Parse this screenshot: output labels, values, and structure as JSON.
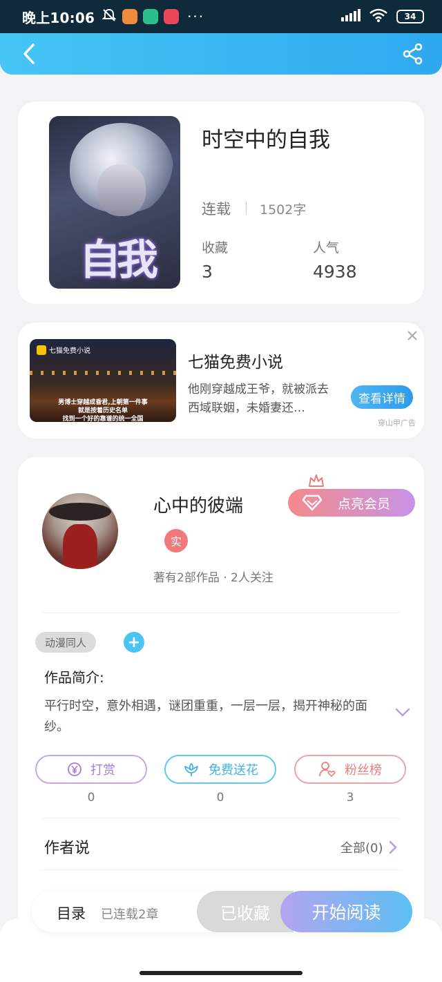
{
  "status_bar": {
    "time": "晚上10:06",
    "battery": "34",
    "more": "···"
  },
  "header": {
    "back_icon": "chevron-left-icon",
    "share_icon": "share-icon",
    "gradient": [
      "#45c6f4",
      "#2fa9ef"
    ]
  },
  "book": {
    "title": "时空中的自我",
    "cover_text": "自我",
    "status": "连载",
    "word_count": "1502字",
    "favorites_label": "收藏",
    "favorites_value": "3",
    "popularity_label": "人气",
    "popularity_value": "4938"
  },
  "ad": {
    "brand": "七猫免费小说",
    "image_caption_1": "男博士穿越成昏君,上朝第一件事",
    "image_caption_2": "就是按着历史名单",
    "image_caption_3": "找到一个好的靠谱的统一全国",
    "title": "七猫免费小说",
    "description": "他刚穿越成王爷，就被派去西域联姻，未婚妻还…",
    "button": "查看详情",
    "source": "穿山甲广告",
    "close_icon": "close-icon"
  },
  "author": {
    "name": "心中的彼端",
    "vip_button": "点亮会员",
    "real_badge": "实",
    "meta": "著有2部作品 · 2人关注",
    "tag": "动漫同人",
    "add_tag": "+",
    "intro_title": "作品简介:",
    "intro_text": "平行时空，意外相遇，谜团重重，一层一层，揭开神秘的面纱。"
  },
  "actions": {
    "reward_label": "打赏",
    "reward_count": "0",
    "flower_label": "免费送花",
    "flower_count": "0",
    "fans_label": "粉丝榜",
    "fans_count": "3"
  },
  "author_says": {
    "title": "作者说",
    "all_link": "全部(0)"
  },
  "bottom_bar": {
    "catalog": "目录",
    "chapters": "已连载2章",
    "collected": "已收藏",
    "start_reading": "开始阅读"
  },
  "colors": {
    "accent_blue": "#2fa9ef",
    "purple": "#a57ed8",
    "pink": "#e37f7f",
    "cyan": "#3fb3e6"
  }
}
